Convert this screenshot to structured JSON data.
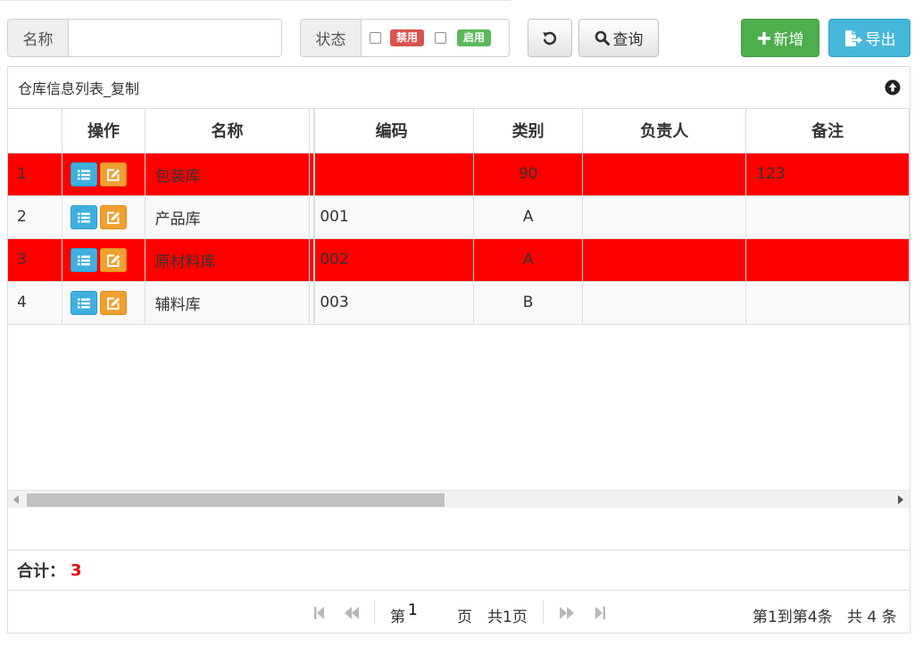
{
  "toolbar": {
    "name_label": "名称",
    "name_value": "",
    "status_label": "状态",
    "disabled_badge": "禁用",
    "enabled_badge": "启用",
    "query_label": "查询",
    "add_label": "新增",
    "export_label": "导出"
  },
  "panel": {
    "title": "仓库信息列表_复制"
  },
  "table": {
    "headers": [
      "",
      "操作",
      "名称",
      "编码",
      "类别",
      "负责人",
      "备注"
    ],
    "rows": [
      {
        "num": "1",
        "name": "包装库",
        "code": "",
        "type": "90",
        "owner": "",
        "note": "123"
      },
      {
        "num": "2",
        "name": "产品库",
        "code": "001",
        "type": "A",
        "owner": "",
        "note": ""
      },
      {
        "num": "3",
        "name": "原材料库",
        "code": "002",
        "type": "A",
        "owner": "",
        "note": ""
      },
      {
        "num": "4",
        "name": "辅料库",
        "code": "003",
        "type": "B",
        "owner": "",
        "note": ""
      }
    ]
  },
  "summary": {
    "label": "合计：",
    "count": "3"
  },
  "pager": {
    "page_prefix": "第",
    "page_value": "1",
    "page_suffix": "页",
    "total_pages": "共1页",
    "range": "第1到第4条",
    "total": "共 4 条"
  },
  "colors": {
    "highlight_row": "#ff0000",
    "success": "#4cae4c",
    "info": "#46b8da",
    "danger": "#d9534f",
    "badge_enabled": "#5cb85c",
    "count": "#e40000"
  }
}
